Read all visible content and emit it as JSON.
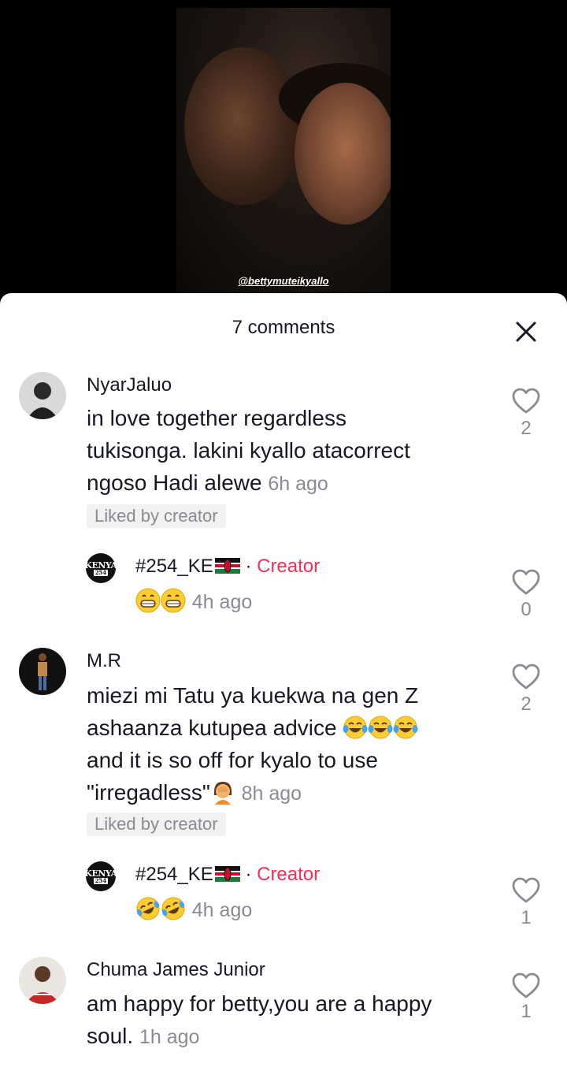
{
  "video": {
    "watermark": "@bettymuteikyallo"
  },
  "sheet": {
    "title": "7 comments"
  },
  "comments": [
    {
      "username": "NyarJaluo",
      "text_lines": [
        "in love together regardless",
        "tukisonga. lakini kyallo atacorrect",
        "ngoso Hadi alewe"
      ],
      "time": "6h ago",
      "liked_by_creator": "Liked by creator",
      "likes": "2",
      "reply": {
        "username": "#254_KE",
        "separator": "·",
        "badge": "Creator",
        "emojis": [
          "grin-face",
          "grin-face"
        ],
        "time": "4h ago",
        "likes": "0"
      }
    },
    {
      "username": "M.R",
      "text_lines": [
        "miezi mi Tatu ya kuekwa na gen Z",
        "ashaanza kutupea advice",
        "and it is so off for kyalo to use",
        "\"irregadless\""
      ],
      "time": "8h ago",
      "liked_by_creator": "Liked by creator",
      "likes": "2",
      "reply": {
        "username": "#254_KE",
        "separator": "·",
        "badge": "Creator",
        "emojis": [
          "rofl-face",
          "rofl-face"
        ],
        "time": "4h ago",
        "likes": "1"
      }
    },
    {
      "username": "Chuma James Junior",
      "text_lines": [
        "am happy for betty,you are a happy",
        "soul."
      ],
      "time": "1h ago",
      "likes": "1"
    }
  ],
  "reply_avatar_text": {
    "line1": "KENYA",
    "line2": "254"
  }
}
